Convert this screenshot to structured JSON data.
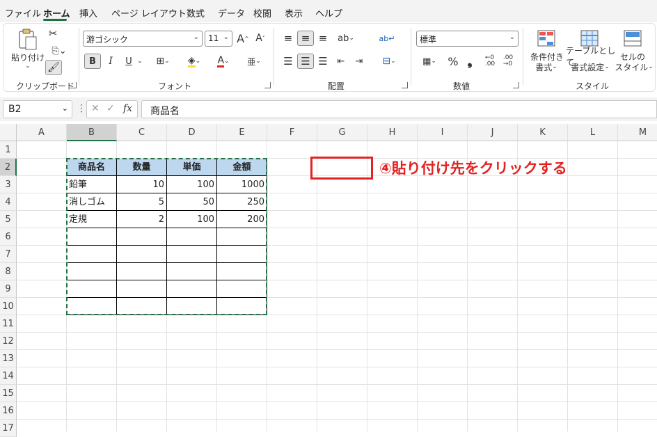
{
  "menu": {
    "file": "ファイル",
    "home": "ホーム",
    "insert": "挿入",
    "page_layout": "ページ レイアウト",
    "formulas": "数式",
    "data": "データ",
    "review": "校閲",
    "view": "表示",
    "help": "ヘルプ"
  },
  "ribbon": {
    "clipboard": {
      "paste_label": "貼り付け",
      "group_label": "クリップボード"
    },
    "font": {
      "font_name": "游ゴシック",
      "font_size": "11",
      "bold": "B",
      "italic": "I",
      "underline": "U",
      "group_label": "フォント"
    },
    "alignment": {
      "group_label": "配置"
    },
    "number": {
      "format": "標準",
      "percent": "%",
      "comma": "❟",
      "group_label": "数値"
    },
    "styles": {
      "conditional_line1": "条件付き",
      "conditional_line2": "書式",
      "table_line1": "テーブルとして",
      "table_line2": "書式設定",
      "cell_line1": "セルの",
      "cell_line2": "スタイル",
      "group_label": "スタイル"
    }
  },
  "formula_bar": {
    "name_box": "B2",
    "fx": "fx",
    "content": "商品名"
  },
  "columns": [
    "A",
    "B",
    "C",
    "D",
    "E",
    "F",
    "G",
    "H",
    "I",
    "J",
    "K",
    "L",
    "M"
  ],
  "rows": [
    "1",
    "2",
    "3",
    "4",
    "5",
    "6",
    "7",
    "8",
    "9",
    "10",
    "11",
    "12",
    "13",
    "14",
    "15",
    "16",
    "17"
  ],
  "table": {
    "headers": [
      "商品名",
      "数量",
      "単価",
      "金額"
    ],
    "rows": [
      [
        "鉛筆",
        "10",
        "100",
        "1000"
      ],
      [
        "消しゴム",
        "5",
        "50",
        "250"
      ],
      [
        "定規",
        "2",
        "100",
        "200"
      ],
      [
        "",
        "",
        "",
        ""
      ],
      [
        "",
        "",
        "",
        ""
      ],
      [
        "",
        "",
        "",
        ""
      ],
      [
        "",
        "",
        "",
        ""
      ],
      [
        "",
        "",
        "",
        ""
      ]
    ]
  },
  "annotation": {
    "text": "④貼り付け先をクリックする",
    "color": "#e52222"
  },
  "colors": {
    "header_fill": "#bdd7ee",
    "copy_border": "#217346",
    "accent": "#1e7145"
  }
}
